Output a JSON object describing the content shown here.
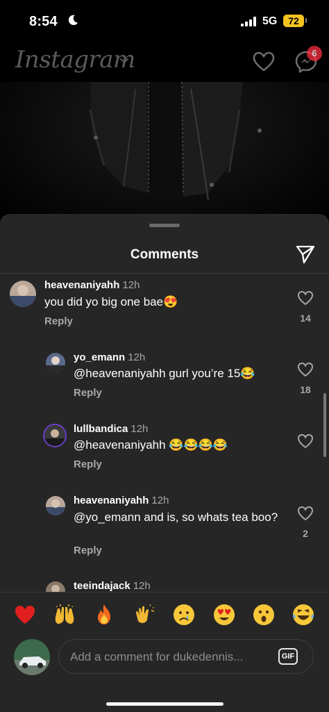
{
  "status_bar": {
    "time": "8:54",
    "network": "5G",
    "battery": "72"
  },
  "header": {
    "logo": "Instagram",
    "dm_badge": "6"
  },
  "sheet": {
    "title": "Comments"
  },
  "comments": [
    {
      "username": "heavenaniyahh",
      "time": "12h",
      "text": "you did yo big one bae😍",
      "reply": "Reply",
      "likes": "14"
    },
    {
      "username": "yo_emann",
      "time": "12h",
      "text": "@heavenaniyahh gurl you’re 15😂",
      "reply": "Reply",
      "likes": "18"
    },
    {
      "username": "lullbandica",
      "time": "12h",
      "text": "@heavenaniyahh 😂😂😂😂",
      "reply": "Reply",
      "likes": ""
    },
    {
      "username": "heavenaniyahh",
      "time": "12h",
      "text": "@yo_emann and is, so whats tea boo?",
      "reply": "Reply",
      "likes": "2"
    },
    {
      "username": "teeindajack",
      "time": "12h"
    }
  ],
  "quick_reactions": [
    "❤️",
    "🙌",
    "🔥",
    "👏",
    "😢",
    "😍",
    "😮",
    "😂"
  ],
  "composer": {
    "placeholder": "Add a comment for dukedennis...",
    "gif_label": "GIF"
  },
  "icons": {
    "moon": "moon-icon",
    "signal": "signal-icon",
    "heart": "heart-icon",
    "messenger": "messenger-icon",
    "share": "send-icon",
    "like": "heart-outline-icon"
  },
  "colors": {
    "background": "#000000",
    "sheet": "#262626",
    "badge": "#ff3040",
    "battery": "#f3c320",
    "secondary_text": "#a8a8a8"
  }
}
